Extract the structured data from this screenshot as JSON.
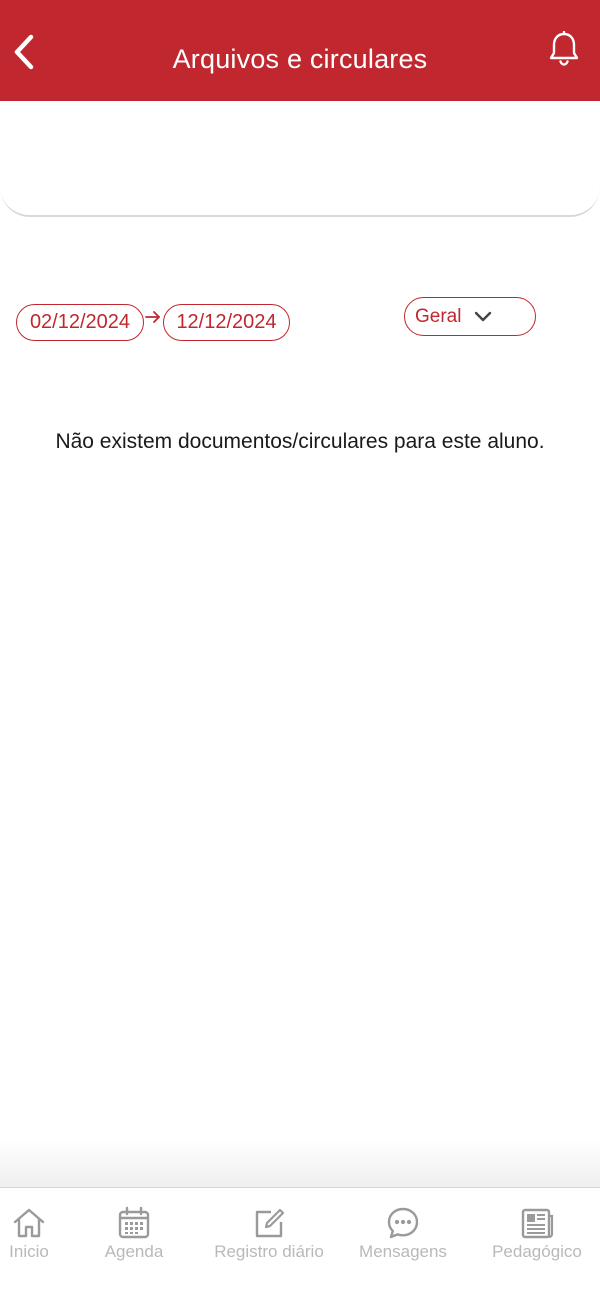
{
  "header": {
    "title": "Arquivos e circulares",
    "background_color": "#c0272f",
    "back_icon": "chevron-left-icon",
    "notification_icon": "bell-icon"
  },
  "filters": {
    "date_from": "02/12/2024",
    "date_to": "12/12/2024",
    "category_selected": "Geral",
    "accent_color": "#c0272f"
  },
  "empty_message": "Não existem documentos/circulares para este aluno.",
  "bottom_nav": {
    "items": [
      {
        "label": "Inicio",
        "icon": "home-icon"
      },
      {
        "label": "Agenda",
        "icon": "calendar-icon"
      },
      {
        "label": "Registro diário",
        "icon": "edit-icon"
      },
      {
        "label": "Mensagens",
        "icon": "chat-icon"
      },
      {
        "label": "Pedagógico",
        "icon": "newspaper-icon"
      }
    ],
    "inactive_color": "#b9b9b9"
  }
}
